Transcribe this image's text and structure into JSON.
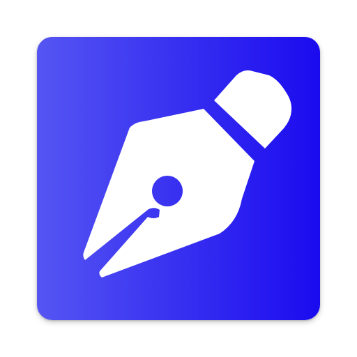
{
  "icon": {
    "name": "fountain-pen-icon",
    "gradient_start": "#5555f2",
    "gradient_end": "#1a0bef",
    "glyph_color": "#ffffff"
  }
}
